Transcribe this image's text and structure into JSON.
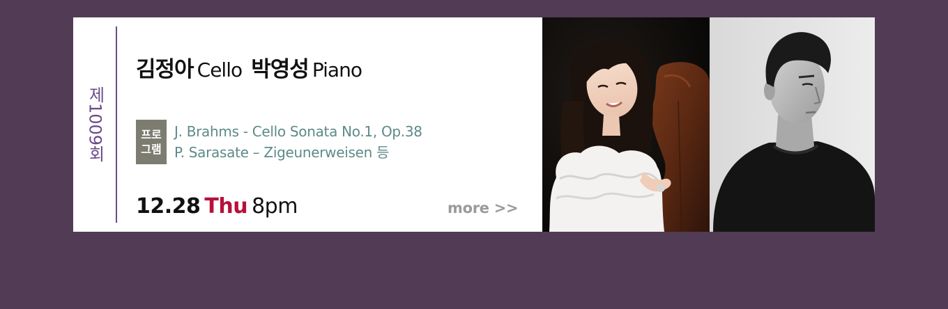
{
  "concert": {
    "edition_label": "제1009회",
    "performers": [
      {
        "name": "김정아",
        "instrument": "Cello"
      },
      {
        "name": "박영성",
        "instrument": "Piano"
      }
    ],
    "program_badge": "프로 그램",
    "program_items": [
      "J. Brahms - Cello Sonata No.1, Op.38",
      "P. Sarasate – Zigeunerweisen 등"
    ],
    "date": "12.28",
    "day": "Thu",
    "time": "8pm",
    "more_label": "more >>"
  },
  "photos": [
    {
      "icon": "photo-cellist",
      "subject": "cellist"
    },
    {
      "icon": "photo-pianist",
      "subject": "pianist"
    }
  ],
  "colors": {
    "page_background": "#523b54",
    "accent_purple": "#6b4a8a",
    "program_text": "#5d8a88",
    "day_red": "#b8103a",
    "badge_gray": "#7c7c70",
    "more_gray": "#9a9a9a"
  }
}
